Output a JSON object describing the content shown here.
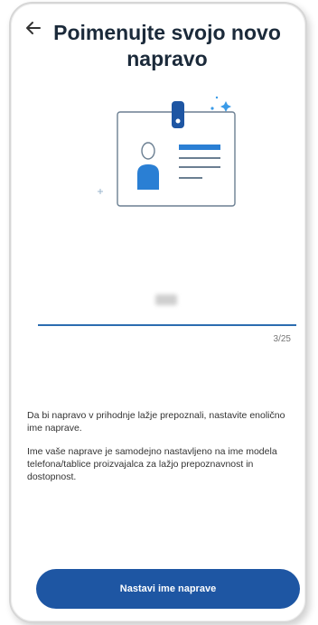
{
  "header": {
    "title": "Poimenujte svojo novo napravo"
  },
  "device_name": {
    "value": "",
    "counter": "3/25"
  },
  "info": {
    "paragraph_1": "Da bi napravo v prihodnje lažje prepoznali, nastavite enolično ime naprave.",
    "paragraph_2": "Ime vaše naprave je samodejno nastavljeno na ime modela telefona/tablice proizvajalca za lažjo prepoznavnost in dostopnost."
  },
  "actions": {
    "primary_label": "Nastavi ime naprave"
  },
  "colors": {
    "accent": "#1e56a3",
    "title": "#1b2a3a",
    "illustration_blue": "#2a7fd4"
  },
  "icons": {
    "back": "arrow-left-icon",
    "illustration": "id-card-icon"
  }
}
